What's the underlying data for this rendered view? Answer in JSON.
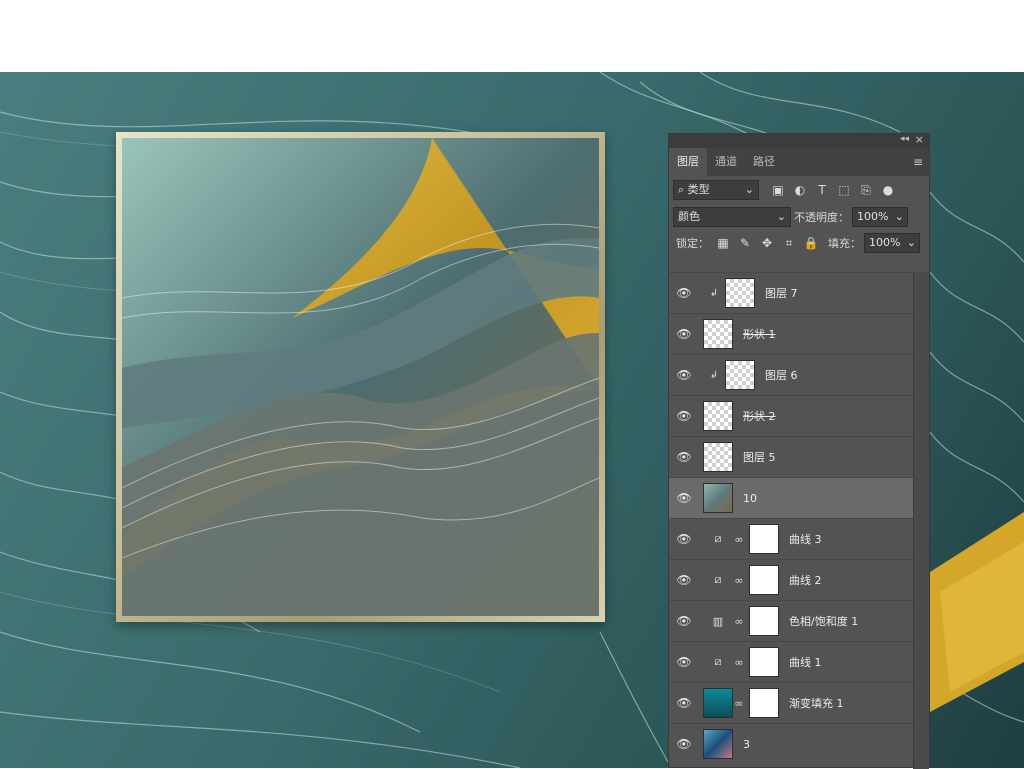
{
  "panel": {
    "tabs": [
      {
        "label": "图层",
        "active": true
      },
      {
        "label": "通道",
        "active": false
      },
      {
        "label": "路径",
        "active": false
      }
    ],
    "filter": {
      "kind_label": "类型"
    },
    "blend_mode": "颜色",
    "opacity_label": "不透明度：",
    "opacity_value": "100%",
    "lock_label": "锁定：",
    "fill_label": "填充：",
    "fill_value": "100%",
    "layers": [
      {
        "name": "图层 7",
        "type": "clipped-pixel"
      },
      {
        "name": "形状 1",
        "type": "shape",
        "strikethrough": true
      },
      {
        "name": "图层 6",
        "type": "clipped-pixel"
      },
      {
        "name": "形状 2",
        "type": "shape",
        "strikethrough": true
      },
      {
        "name": "图层 5",
        "type": "pixel"
      },
      {
        "name": "10",
        "type": "pixel",
        "selected": true
      },
      {
        "name": "曲线 3",
        "type": "adjustment-curves"
      },
      {
        "name": "曲线 2",
        "type": "adjustment-curves"
      },
      {
        "name": "色相/饱和度 1",
        "type": "adjustment-hue"
      },
      {
        "name": "曲线 1",
        "type": "adjustment-curves"
      },
      {
        "name": "渐变填充 1",
        "type": "gradient-fill"
      },
      {
        "name": "3",
        "type": "pixel-image"
      }
    ]
  },
  "colors": {
    "panel_bg": "#535353",
    "selected_layer": "#6a6a6a",
    "background_teal": "#3a6a6b",
    "gold": "#d4a62a"
  }
}
